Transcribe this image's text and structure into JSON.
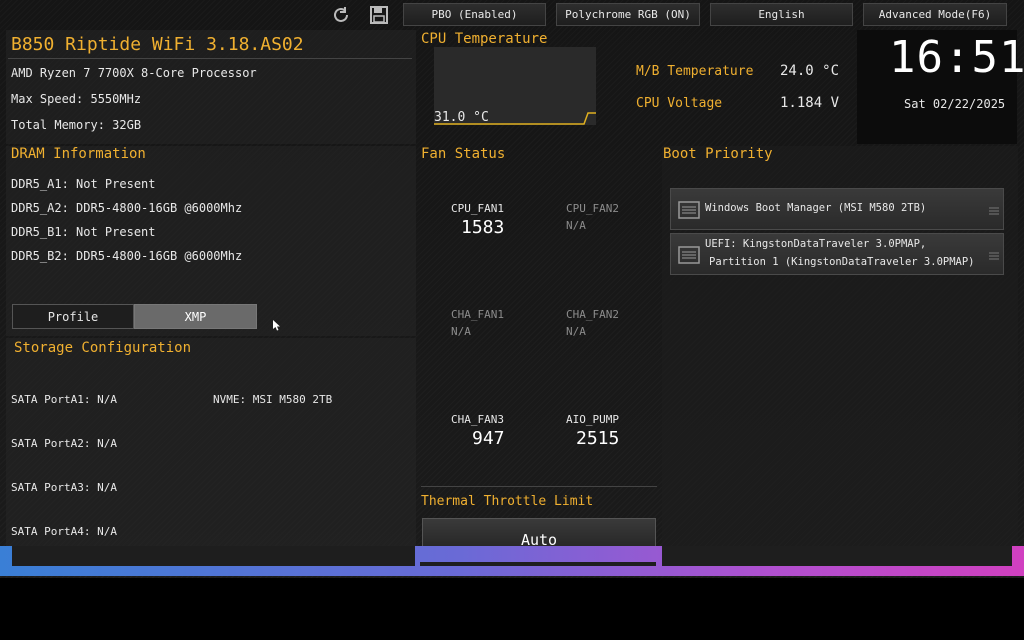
{
  "toolbar": {
    "refresh_icon": "refresh-icon",
    "save_icon": "save-icon",
    "pbo": "PBO (Enabled)",
    "rgb": "Polychrome RGB (ON)",
    "language": "English",
    "advanced": "Advanced Mode(F6)"
  },
  "system": {
    "board": "B850 Riptide WiFi 3.18.AS02",
    "cpu": "AMD Ryzen 7 7700X 8-Core Processor",
    "max_speed": "Max Speed: 5550MHz",
    "total_memory": "Total Memory: 32GB"
  },
  "cpu_temp": {
    "title": "CPU Temperature",
    "value": "31.0 °C"
  },
  "sensors": {
    "mb_temp_label": "M/B Temperature",
    "mb_temp_value": "24.0 °C",
    "cpu_voltage_label": "CPU Voltage",
    "cpu_voltage_value": "1.184 V"
  },
  "clock": {
    "time": "16:51",
    "date": "Sat 02/22/2025"
  },
  "dram": {
    "title": "DRAM Information",
    "slots": [
      "DDR5_A1: Not Present",
      "DDR5_A2: DDR5-4800-16GB @6000Mhz",
      "DDR5_B1: Not Present",
      "DDR5_B2: DDR5-4800-16GB @6000Mhz"
    ],
    "profile_label": "Profile",
    "xmp_label": "XMP"
  },
  "storage": {
    "title": "Storage Configuration",
    "ports": [
      "SATA PortA1: N/A",
      "SATA PortA2: N/A",
      "SATA PortA3: N/A",
      "SATA PortA4: N/A"
    ],
    "nvme": "NVME: MSI M580 2TB"
  },
  "fans": {
    "title": "Fan Status",
    "items": [
      {
        "name": "CPU_FAN1",
        "value": "1583"
      },
      {
        "name": "CPU_FAN2",
        "value": "N/A"
      },
      {
        "name": "CHA_FAN1",
        "value": "N/A"
      },
      {
        "name": "CHA_FAN2",
        "value": "N/A"
      },
      {
        "name": "CHA_FAN3",
        "value": "947"
      },
      {
        "name": "AIO_PUMP",
        "value": "2515"
      }
    ]
  },
  "thermal": {
    "title": "Thermal Throttle Limit",
    "value": "Auto"
  },
  "boot": {
    "title": "Boot Priority",
    "items": [
      {
        "line1": "Windows Boot Manager (MSI M580 2TB)",
        "line2": ""
      },
      {
        "line1": "UEFI: KingstonDataTraveler 3.0PMAP,",
        "line2": "Partition 1 (KingstonDataTraveler 3.0PMAP)"
      }
    ]
  },
  "colors": {
    "accent": "#f0b030",
    "bar_left": "#3a7fd6",
    "bar_right": "#d040c0"
  }
}
